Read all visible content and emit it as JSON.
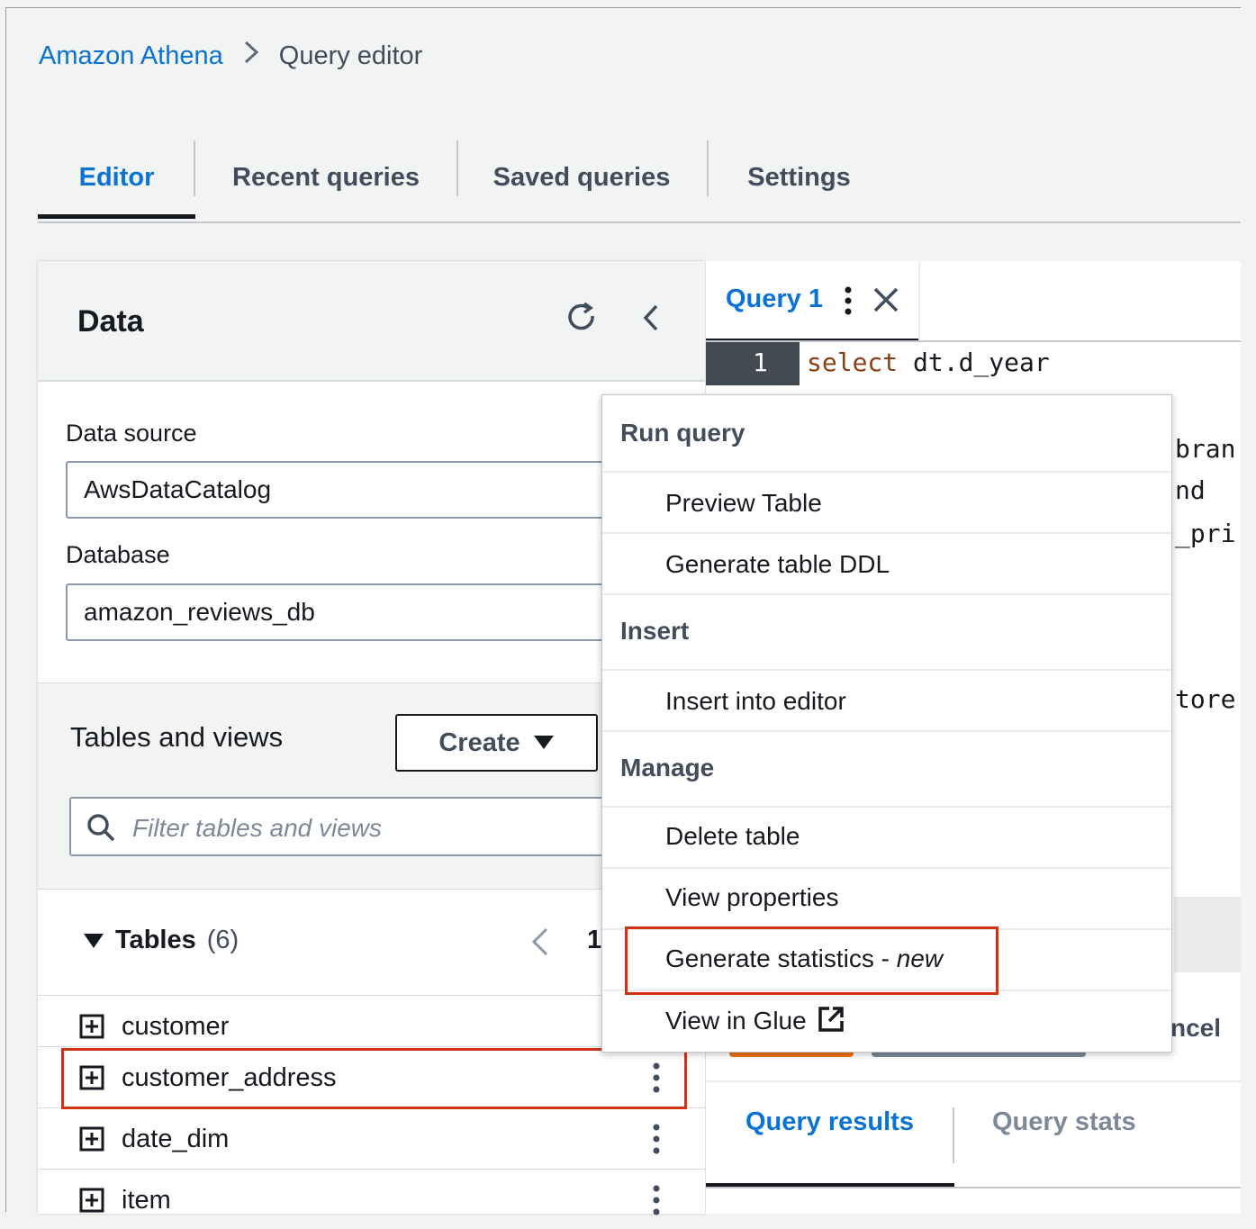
{
  "breadcrumb": {
    "root": "Amazon Athena",
    "current": "Query editor"
  },
  "main_tabs": [
    "Editor",
    "Recent queries",
    "Saved queries",
    "Settings"
  ],
  "data_panel": {
    "title": "Data",
    "data_source_label": "Data source",
    "data_source_value": "AwsDataCatalog",
    "database_label": "Database",
    "database_value": "amazon_reviews_db",
    "tables_views_title": "Tables and views",
    "create_label": "Create",
    "filter_placeholder": "Filter tables and views",
    "tables_label": "Tables",
    "tables_count": "(6)",
    "page_number": "1",
    "tables": [
      "customer",
      "customer_address",
      "date_dim",
      "item"
    ]
  },
  "query_tab": {
    "label": "Query 1"
  },
  "editor": {
    "line_number": "1",
    "keyword": "select",
    "code": " dt.d_year",
    "fragments": [
      "bran",
      "nd",
      "_pri",
      "tore"
    ]
  },
  "ghost_button": "ncel",
  "results_tabs": [
    "Query results",
    "Query stats"
  ],
  "context_menu": {
    "groups": [
      {
        "label": "Run query",
        "items": [
          "Preview Table",
          "Generate table DDL"
        ]
      },
      {
        "label": "Insert",
        "items": [
          "Insert into editor"
        ]
      },
      {
        "label": "Manage",
        "items": [
          "Delete table",
          "View properties",
          "Generate statistics - ",
          "View in Glue"
        ]
      }
    ],
    "new_tag": "new"
  },
  "colors": {
    "accent": "#0972d3",
    "highlight": "#d13212",
    "run": "#ec7211"
  }
}
